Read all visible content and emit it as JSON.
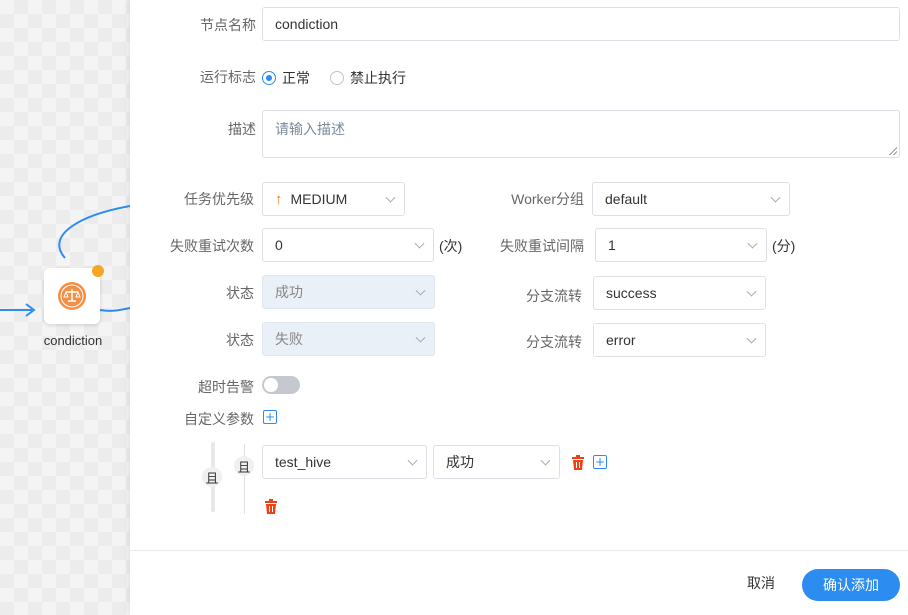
{
  "canvas": {
    "node_label": "condiction",
    "node_icon": "condition-scale-icon",
    "status_dot_color": "#f5a623"
  },
  "form": {
    "node_name": {
      "label": "节点名称",
      "value": "condiction"
    },
    "run_flag": {
      "label": "运行标志",
      "options": [
        "正常",
        "禁止执行"
      ],
      "selected": "正常"
    },
    "description": {
      "label": "描述",
      "placeholder": "请输入描述"
    },
    "priority": {
      "label": "任务优先级",
      "value": "MEDIUM",
      "icon": "arrow-up-icon"
    },
    "worker_group": {
      "label": "Worker分组",
      "value": "default"
    },
    "retry_times": {
      "label": "失败重试次数",
      "value": "0",
      "unit": "(次)"
    },
    "retry_interval": {
      "label": "失败重试间隔",
      "value": "1",
      "unit": "(分)"
    },
    "success_branch": {
      "state_label": "状态",
      "state_value": "成功",
      "branch_label": "分支流转",
      "branch_value": "success"
    },
    "failure_branch": {
      "state_label": "状态",
      "state_value": "失败",
      "branch_label": "分支流转",
      "branch_value": "error"
    },
    "timeout_alarm": {
      "label": "超时告警",
      "enabled": false
    },
    "custom_params": {
      "label": "自定义参数"
    },
    "condition": {
      "outer_relation": "且",
      "inner_relation": "且",
      "task": "test_hive",
      "state": "成功"
    }
  },
  "footer": {
    "cancel": "取消",
    "confirm": "确认添加"
  },
  "colors": {
    "primary": "#2d8cf0",
    "danger": "#ed4014",
    "priority": "#f07b23"
  }
}
